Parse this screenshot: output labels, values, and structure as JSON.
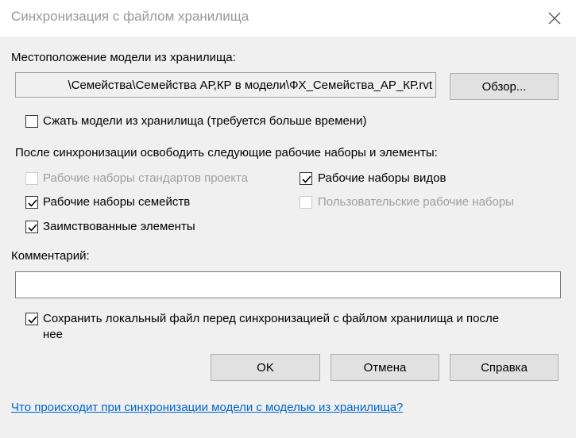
{
  "window": {
    "title": "Синхронизация с файлом хранилища"
  },
  "location": {
    "label": "Местоположение модели из хранилища:",
    "path_value": "\\Семейства\\Семейства АР,КР в модели\\ФХ_Семейства_АР_КР.rvt",
    "browse_label": "Обзор..."
  },
  "compress": {
    "label": "Сжать модели из хранилища (требуется больше времени)",
    "checked": false
  },
  "release": {
    "heading": "После синхронизации освободить следующие рабочие наборы и элементы:",
    "options": [
      {
        "label": "Рабочие наборы стандартов проекта",
        "checked": false,
        "enabled": false
      },
      {
        "label": "Рабочие наборы видов",
        "checked": true,
        "enabled": true
      },
      {
        "label": "Рабочие наборы семейств",
        "checked": true,
        "enabled": true
      },
      {
        "label": "Пользовательские рабочие наборы",
        "checked": false,
        "enabled": false
      },
      {
        "label": "Заимствованные элементы",
        "checked": true,
        "enabled": true
      }
    ]
  },
  "comment": {
    "label": "Комментарий:",
    "value": ""
  },
  "save_local": {
    "label_line1": "Сохранить локальный файл перед синхронизацией с файлом хранилища и после",
    "label_line2": "нее",
    "checked": true
  },
  "buttons": {
    "ok": "OK",
    "cancel": "Отмена",
    "help": "Справка"
  },
  "help_link": "Что происходит при синхронизации модели с моделью из хранилища?"
}
